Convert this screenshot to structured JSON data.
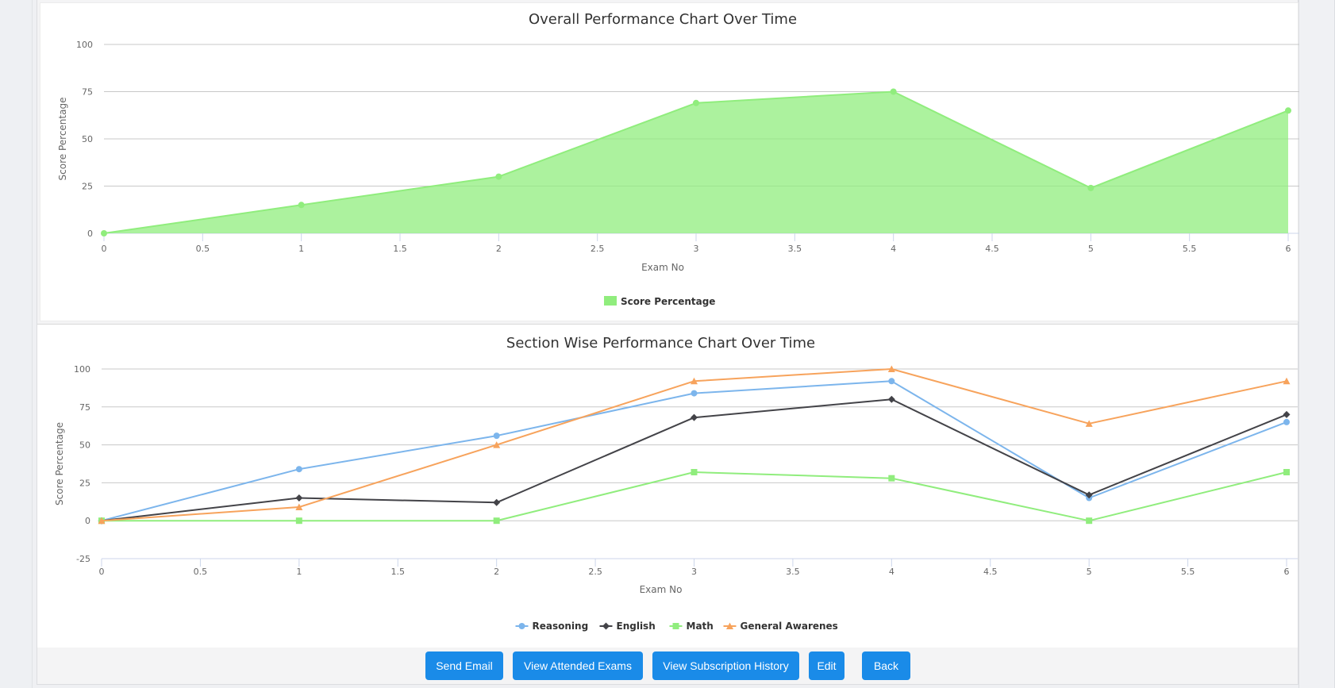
{
  "chart_data": [
    {
      "type": "area",
      "title": "Overall Performance Chart Over Time",
      "xlabel": "Exam No",
      "ylabel": "Score Percentage",
      "xlim": [
        0,
        6
      ],
      "ylim": [
        0,
        100
      ],
      "x_ticks": [
        "0",
        "0.5",
        "1",
        "1.5",
        "2",
        "2.5",
        "3",
        "3.5",
        "4",
        "4.5",
        "5",
        "5.5",
        "6"
      ],
      "y_ticks": [
        "0",
        "25",
        "50",
        "75",
        "100"
      ],
      "grid": true,
      "legend_position": "bottom-center",
      "x": [
        0,
        1,
        2,
        3,
        4,
        5,
        6
      ],
      "series": [
        {
          "name": "Score Percentage",
          "color": "#90ed7d",
          "marker": "circle",
          "values": [
            0,
            15,
            30,
            69,
            75,
            24,
            65
          ]
        }
      ]
    },
    {
      "type": "line",
      "title": "Section Wise Performance Chart Over Time",
      "xlabel": "Exam No",
      "ylabel": "Score Percentage",
      "xlim": [
        0,
        6
      ],
      "ylim": [
        -25,
        100
      ],
      "x_ticks": [
        "0",
        "0.5",
        "1",
        "1.5",
        "2",
        "2.5",
        "3",
        "3.5",
        "4",
        "4.5",
        "5",
        "5.5",
        "6"
      ],
      "y_ticks": [
        "-25",
        "0",
        "25",
        "50",
        "75",
        "100"
      ],
      "grid": true,
      "legend_position": "bottom-center",
      "x": [
        0,
        1,
        2,
        3,
        4,
        5,
        6
      ],
      "series": [
        {
          "name": "Reasoning",
          "color": "#7cb5ec",
          "marker": "circle",
          "values": [
            0,
            34,
            56,
            84,
            92,
            15,
            65
          ]
        },
        {
          "name": "English",
          "color": "#434348",
          "marker": "diamond",
          "values": [
            0,
            15,
            12,
            68,
            80,
            17,
            70
          ]
        },
        {
          "name": "Math",
          "color": "#90ed7d",
          "marker": "square",
          "values": [
            0,
            0,
            0,
            32,
            28,
            0,
            32
          ]
        },
        {
          "name": "General Awarenes",
          "color": "#f7a35c",
          "marker": "triangle",
          "values": [
            0,
            9,
            50,
            92,
            100,
            64,
            92
          ]
        }
      ]
    }
  ],
  "actions": {
    "send_email": "Send Email",
    "view_attended_exams": "View Attended Exams",
    "view_subscription_history": "View Subscription History",
    "edit": "Edit",
    "back": "Back"
  },
  "colors": {
    "button_primary": "#1a8be8"
  }
}
